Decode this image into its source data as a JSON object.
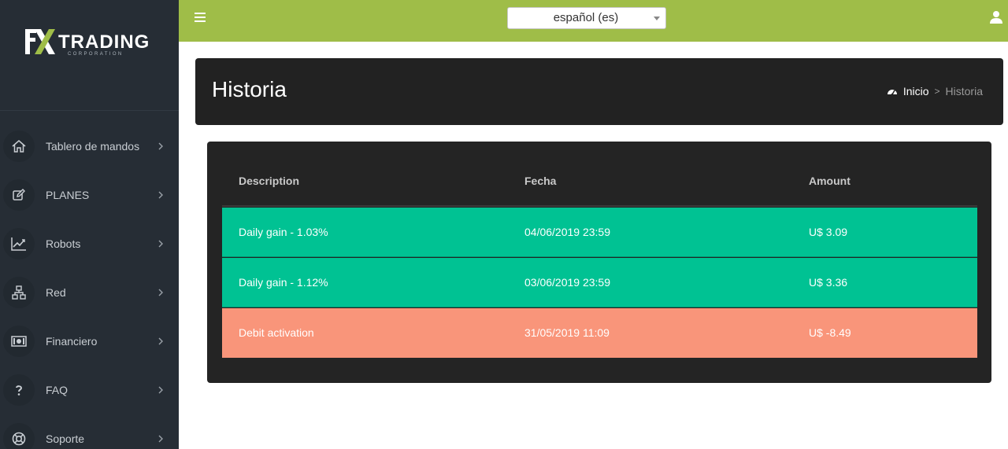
{
  "brand": {
    "name": "TRADING",
    "tagline": "CORPORATION",
    "mark": "FX"
  },
  "topbar": {
    "language_value": "español (es)"
  },
  "sidebar": {
    "items": [
      {
        "label": "Tablero de mandos",
        "icon": "home-icon"
      },
      {
        "label": "PLANES",
        "icon": "edit-icon"
      },
      {
        "label": "Robots",
        "icon": "chart-line-icon"
      },
      {
        "label": "Red",
        "icon": "network-icon"
      },
      {
        "label": "Financiero",
        "icon": "money-icon"
      },
      {
        "label": "FAQ",
        "icon": "question-icon"
      },
      {
        "label": "Soporte",
        "icon": "lifebuoy-icon"
      }
    ]
  },
  "page": {
    "title": "Historia",
    "breadcrumb": {
      "home": "Inicio",
      "separator": ">",
      "current": "Historia"
    }
  },
  "table": {
    "headers": [
      "Description",
      "Fecha",
      "Amount"
    ],
    "rows": [
      {
        "description": "Daily gain - 1.03%",
        "date": "04/06/2019 23:59",
        "amount": "U$ 3.09",
        "color": "#00c293"
      },
      {
        "description": "Daily gain - 1.12%",
        "date": "03/06/2019 23:59",
        "amount": "U$ 3.36",
        "color": "#00c293"
      },
      {
        "description": "Debit activation",
        "date": "31/05/2019 11:09",
        "amount": "U$ -8.49",
        "color": "#f9957a"
      }
    ]
  },
  "colors": {
    "sidebar": "#262d35",
    "topbar": "#9fbd48",
    "header": "#222222",
    "card": "#242424",
    "gain": "#00c293",
    "debit": "#f9957a"
  }
}
